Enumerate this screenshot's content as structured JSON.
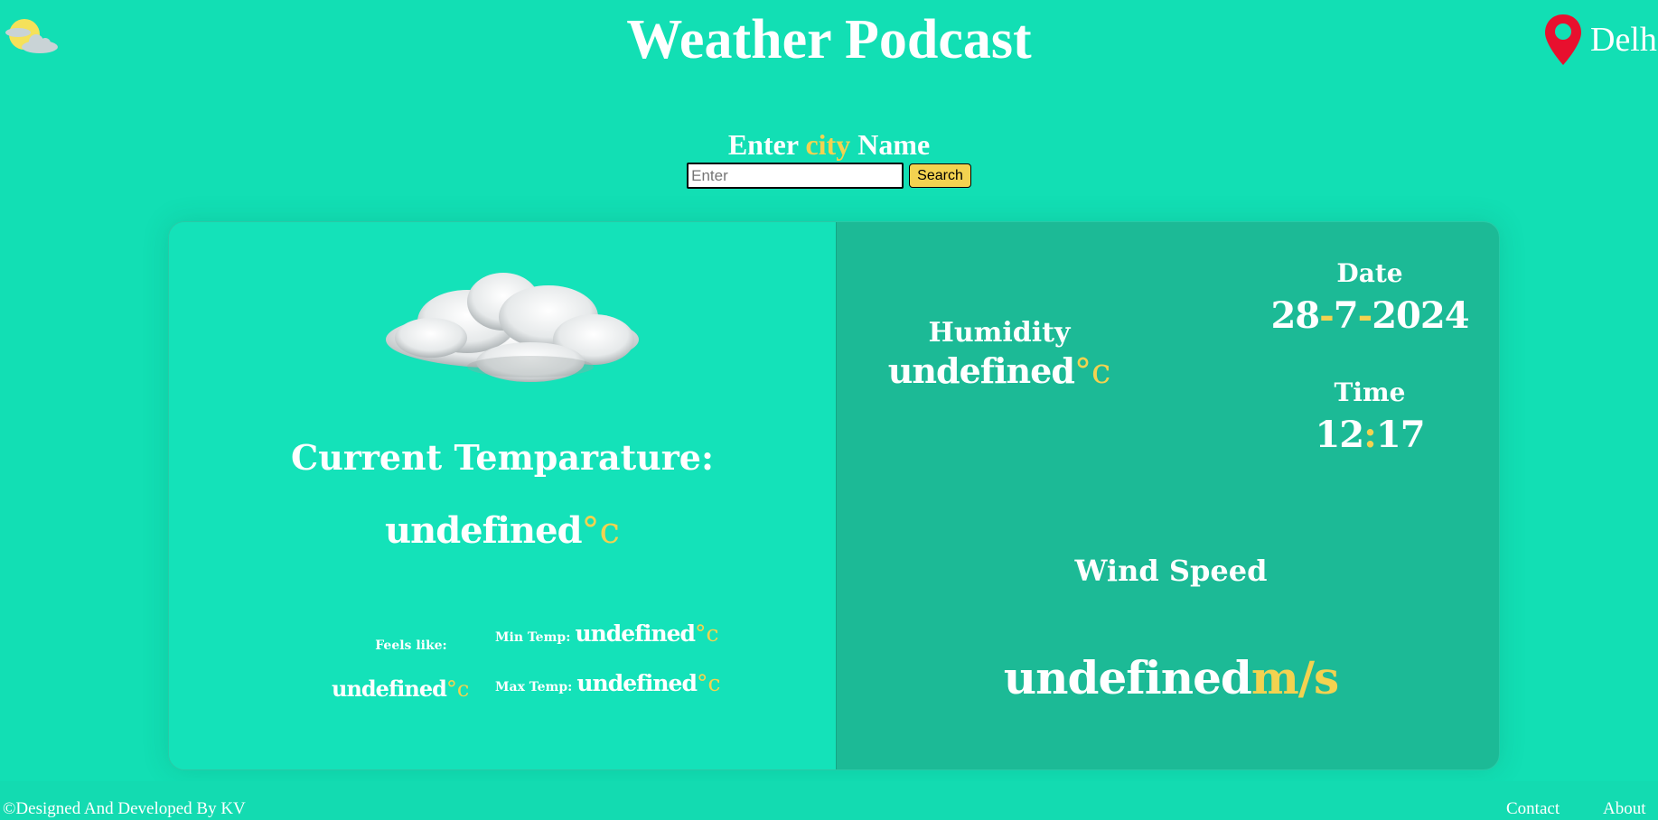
{
  "header": {
    "title": "Weather Podcast",
    "location_label": "Delh",
    "logo_icon": "weather-logo-icon",
    "location_icon": "map-pin-icon"
  },
  "search": {
    "label_pre": "Enter ",
    "label_accent": "city",
    "label_post": " Name",
    "placeholder": "Enter",
    "button_label": "Search"
  },
  "current": {
    "cloud_icon": "cloud-image",
    "heading": "Current Temparature:",
    "temp_value": "undefined",
    "temp_unit": "°c",
    "feels_label": "Feels like:",
    "feels_value": "undefined",
    "feels_unit": "°c",
    "min_label": "Min Temp:",
    "min_value": "undefined",
    "min_unit": "°c",
    "max_label": "Max Temp:",
    "max_value": "undefined",
    "max_unit": "°c"
  },
  "details": {
    "humidity_label": "Humidity",
    "humidity_value": "undefined",
    "humidity_unit": "°c",
    "date_label": "Date",
    "date_day": "28",
    "date_sep": "-",
    "date_month": "7",
    "date_year": "2024",
    "time_label": "Time",
    "time_hour": "12",
    "time_sep": ":",
    "time_minute": "17",
    "wind_label": "Wind Speed",
    "wind_value": "undefined",
    "wind_unit": "m/s"
  },
  "footer": {
    "copyright": "©Designed And Developed By KV",
    "contact_label": "Contact",
    "about_label": "About"
  },
  "colors": {
    "background": "#12dfb4",
    "panel_right": "#1cba96",
    "accent": "#f3d250",
    "pin": "#e8102e"
  }
}
